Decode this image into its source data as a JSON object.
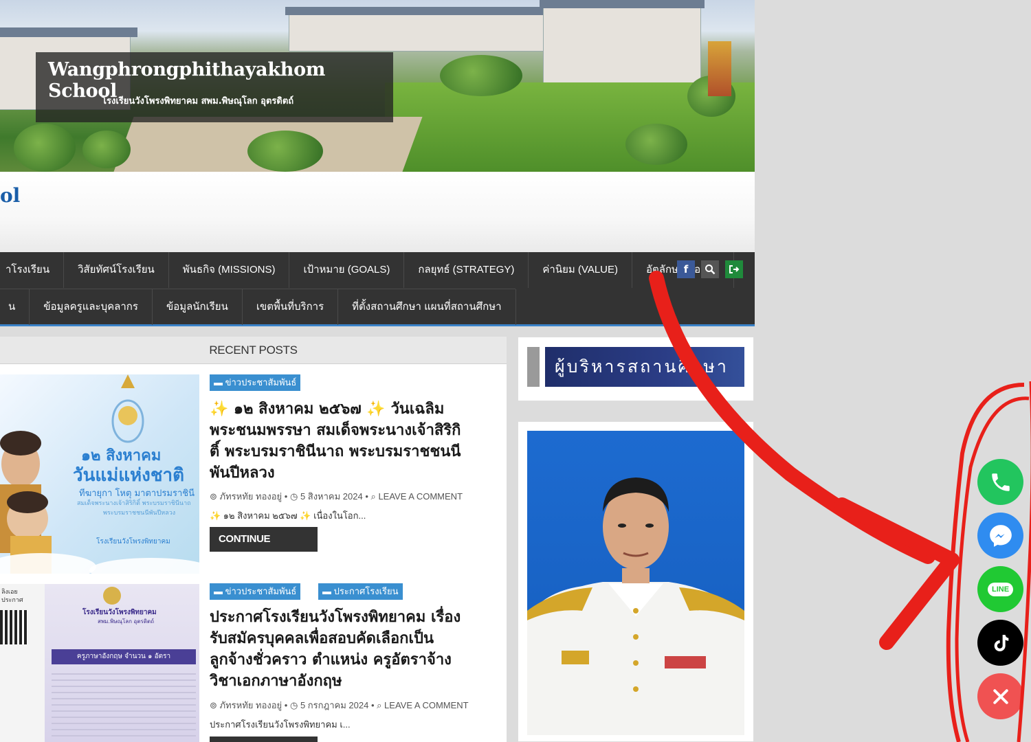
{
  "header": {
    "title": "Wangphrongphithayakhom School",
    "subtitle": "โรงเรียนวังโพรงพิทยาคม สพม.พิษณุโลก อุตรดิตถ์",
    "title_fragment": "ol"
  },
  "nav": {
    "row1": [
      "าโรงเรียน",
      "วิสัยทัศน์โรงเรียน",
      "พันธกิจ (MISSIONS)",
      "เป้าหมาย (GOALS)",
      "กลยุทธ์ (STRATEGY)",
      "ค่านิยม (VALUE)",
      "อัตลักษณ์/เอกลัก"
    ],
    "row2": [
      "น",
      "ข้อมูลครูและบุคลากร",
      "ข้อมูลนักเรียน",
      "เขตพื้นที่บริการ",
      "ที่ตั้งสถานศึกษา แผนที่สถานศึกษา"
    ],
    "icons": {
      "facebook": "f",
      "search": "search-icon",
      "login": "login-icon"
    }
  },
  "main": {
    "section_title": "RECENT POSTS",
    "posts": [
      {
        "categories": [
          "ข่าวประชาสัมพันธ์"
        ],
        "title": "✨ ๑๒ สิงหาคม ๒๕๖๗ ✨ วันเฉลิมพระชนมพรรษา สมเด็จพระนางเจ้าสิริกิติ์ พระบรมราชินีนาถ พระบรมราชชนนีพันปีหลวง",
        "title_lines": [
          "✨ ๑๒ สิงหาคม ๒๕๖๗ ✨ วันเฉลิม",
          "พระชนมพรรษา สมเด็จพระนางเจ้าสิริกิ",
          "ติ์ พระบรมราชินีนาถ พระบรมราชชนนี",
          "พันปีหลวง"
        ],
        "author": "ภัทรหทัย ทองอยู่",
        "date": "5 สิงหาคม 2024",
        "comment": "LEAVE A COMMENT",
        "excerpt": "✨ ๑๒ สิงหาคม ๒๕๖๗ ✨ เนื่องในโอก...",
        "button": "CONTINUE READING",
        "thumb_text": {
          "date": "๑๒ สิงหาคม",
          "headline": "วันแม่แห่งชาติ",
          "line1": "ทีฆายุกา โหตุ มาตาปรมราชินี",
          "line2": "สมเด็จพระนางเจ้าสิริกิติ์ พระบรมราชินีนาถ",
          "line3": "พระบรมราชชนนีพันปีหลวง",
          "school": "โรงเรียนวังโพรงพิทยาคม"
        }
      },
      {
        "categories": [
          "ข่าวประชาสัมพันธ์",
          "ประกาศโรงเรียน"
        ],
        "title_lines": [
          "ประกาศโรงเรียนวังโพรงพิทยาคม เรื่อง",
          "รับสมัครบุคคลเพื่อสอบคัดเลือกเป็น",
          "ลูกจ้างชั่วคราว ตำแหน่ง ครูอัตราจ้าง",
          "วิชาเอกภาษาอังกฤษ"
        ],
        "author": "ภัทรหทัย ทองอยู่",
        "date": "5 กรกฎาคม 2024",
        "comment": "LEAVE A COMMENT",
        "excerpt": "ประกาศโรงเรียนวังโพรงพิทยาคม เ...",
        "thumb_text": {
          "school": "โรงเรียนวังโพรงพิทยาคม",
          "area": "สพม.พิษณุโลก อุตรดิตถ์",
          "banner": "ครูภาษาอังกฤษ จำนวน ๑ อัตรา",
          "left1": "ลิงเอย",
          "left2": "ประกาศ"
        }
      }
    ]
  },
  "sidebar": {
    "banner": "ผู้บริหารสถานศึกษา"
  },
  "contact": {
    "line_label": "LINE"
  },
  "colors": {
    "nav_bg": "#333333",
    "accent": "#3a8fd0",
    "annotation": "#e8201a"
  }
}
